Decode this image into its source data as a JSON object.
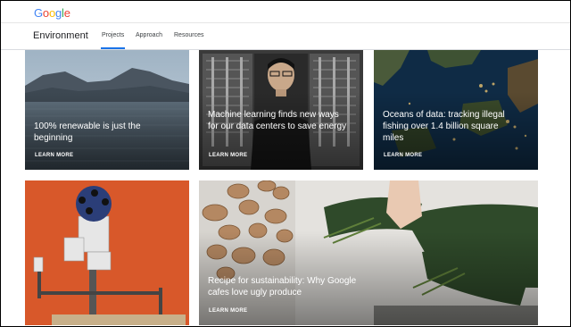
{
  "header": {
    "logo_letters": [
      {
        "ch": "G",
        "color": "#4285F4"
      },
      {
        "ch": "o",
        "color": "#EA4335"
      },
      {
        "ch": "o",
        "color": "#FBBC05"
      },
      {
        "ch": "g",
        "color": "#4285F4"
      },
      {
        "ch": "l",
        "color": "#34A853"
      },
      {
        "ch": "e",
        "color": "#EA4335"
      }
    ]
  },
  "nav": {
    "section_title": "Environment",
    "links": [
      "Projects",
      "Approach",
      "Resources"
    ],
    "active": "Projects",
    "accent": "#1a73e8"
  },
  "cards": [
    {
      "title": "100% renewable is just the beginning",
      "cta": "LEARN MORE"
    },
    {
      "title": "Machine learning finds new ways for our data centers to save energy",
      "cta": "LEARN MORE"
    },
    {
      "title": "Oceans of data: tracking illegal fishing over 1.4 billion square miles",
      "cta": "LEARN MORE"
    },
    {
      "title": "",
      "cta": ""
    },
    {
      "title": "Recipe for sustainability: Why Google cafes love ugly produce",
      "cta": "LEARN MORE"
    }
  ]
}
